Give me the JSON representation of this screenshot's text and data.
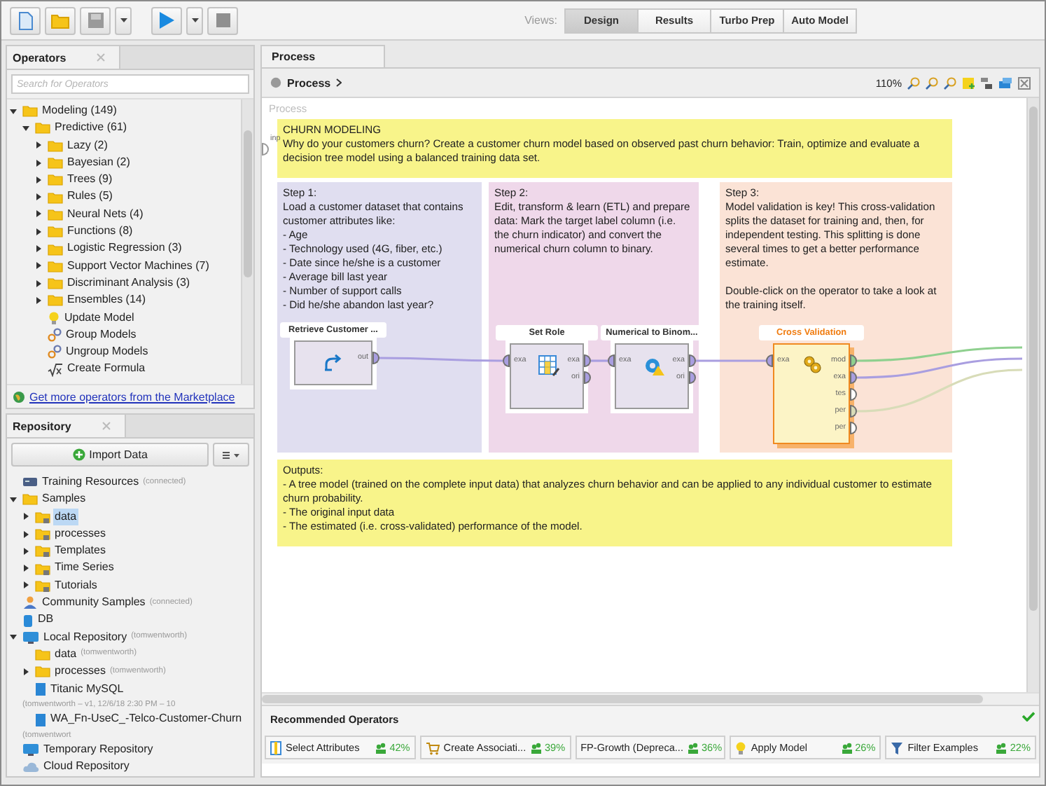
{
  "toolbar": {
    "views_label": "Views:",
    "views": [
      {
        "label": "Design",
        "selected": true
      },
      {
        "label": "Results",
        "selected": false
      },
      {
        "label": "Turbo Prep",
        "selected": false
      },
      {
        "label": "Auto Model",
        "selected": false
      }
    ]
  },
  "operators_panel": {
    "title": "Operators",
    "search": {
      "placeholder": "Search for Operators"
    },
    "tree": [
      {
        "label": "Modeling (149)",
        "kind": "folder",
        "expanded": true,
        "children": [
          {
            "label": "Predictive (61)",
            "kind": "folder",
            "expanded": true,
            "children": [
              {
                "label": "Lazy (2)",
                "kind": "folder",
                "expanded": false
              },
              {
                "label": "Bayesian (2)",
                "kind": "folder",
                "expanded": false
              },
              {
                "label": "Trees (9)",
                "kind": "folder",
                "expanded": false
              },
              {
                "label": "Rules (5)",
                "kind": "folder",
                "expanded": false
              },
              {
                "label": "Neural Nets (4)",
                "kind": "folder",
                "expanded": false
              },
              {
                "label": "Functions (8)",
                "kind": "folder",
                "expanded": false
              },
              {
                "label": "Logistic Regression (3)",
                "kind": "folder",
                "expanded": false
              },
              {
                "label": "Support Vector Machines (7)",
                "kind": "folder",
                "expanded": false
              },
              {
                "label": "Discriminant Analysis (3)",
                "kind": "folder",
                "expanded": false
              },
              {
                "label": "Ensembles (14)",
                "kind": "folder",
                "expanded": false
              },
              {
                "label": "Update Model",
                "kind": "bulb"
              },
              {
                "label": "Group Models",
                "kind": "chain"
              },
              {
                "label": "Ungroup Models",
                "kind": "chain"
              },
              {
                "label": "Create Formula",
                "kind": "formula"
              }
            ]
          }
        ]
      }
    ],
    "marketplace_link": "Get more operators from the Marketplace"
  },
  "repository_panel": {
    "title": "Repository",
    "import_button": "Import Data",
    "tree": [
      {
        "label": "Training Resources",
        "note": "(connected)",
        "kind": "server",
        "selected": false
      },
      {
        "label": "Samples",
        "kind": "folder",
        "expanded": true,
        "selected": false,
        "children": [
          {
            "label": "data",
            "kind": "sample_folder",
            "expanded": false,
            "selected": true
          },
          {
            "label": "processes",
            "kind": "sample_folder",
            "expanded": false,
            "selected": false
          },
          {
            "label": "Templates",
            "kind": "sample_folder",
            "expanded": false,
            "selected": false
          },
          {
            "label": "Time Series",
            "kind": "sample_folder",
            "expanded": false,
            "selected": false
          },
          {
            "label": "Tutorials",
            "kind": "sample_folder",
            "expanded": false,
            "selected": false
          }
        ]
      },
      {
        "label": "Community Samples",
        "note": "(connected)",
        "kind": "community",
        "selected": false
      },
      {
        "label": "DB",
        "kind": "database",
        "selected": false
      },
      {
        "label": "Local Repository",
        "note": "(tomwentworth)",
        "kind": "repository",
        "expanded": true,
        "selected": false,
        "children": [
          {
            "label": "data",
            "note": "(tomwentworth)",
            "kind": "folder",
            "selected": false
          },
          {
            "label": "processes",
            "note": "(tomwentworth)",
            "kind": "folder",
            "expanded": false,
            "selected": false
          },
          {
            "label": "Titanic MySQL",
            "note": "(tomwentworth – v1, 12/6/18 2:30 PM – 10",
            "kind": "datafile",
            "selected": false
          },
          {
            "label": "WA_Fn-UseC_-Telco-Customer-Churn",
            "note": "(tomwentwort",
            "kind": "datafile",
            "selected": false
          }
        ]
      },
      {
        "label": "Temporary Repository",
        "kind": "repository",
        "selected": false
      },
      {
        "label": "Cloud Repository",
        "kind": "cloud",
        "selected": false
      }
    ]
  },
  "process_panel": {
    "tab": "Process",
    "breadcrumb": "Process",
    "zoom": "110%",
    "canvas": {
      "label": "Process",
      "input_port": "inp",
      "notes": [
        {
          "color": "#f8f48a",
          "paragraphs": [
            [
              "CHURN MODELING",
              "Why do your customers churn? Create a customer churn model based on observed past churn behavior: Train, optimize and evaluate a decision tree model using a balanced training data set."
            ]
          ]
        },
        {
          "color": "#e0def0",
          "paragraphs": [
            [
              "Step 1:",
              "Load a customer dataset that contains customer attributes like:",
              "- Age",
              "- Technology used (4G, fiber, etc.)",
              "- Date since he/she is a customer",
              "- Average bill last year",
              "- Number of support calls",
              "- Did he/she abandon last year?"
            ]
          ]
        },
        {
          "color": "#efd8ea",
          "paragraphs": [
            [
              "Step 2:",
              "Edit, transform & learn (ETL) and prepare data: Mark the target label column (i.e. the churn indicator) and convert the numerical churn column to binary."
            ]
          ]
        },
        {
          "color": "#fbe3d6",
          "paragraphs": [
            [
              "Step 3:",
              "Model validation is key! This cross-validation splits the dataset for training and, then, for independent testing. This splitting is done several times to get a better performance estimate."
            ],
            [
              "Double-click on the operator to take a look at the training itself."
            ]
          ]
        },
        {
          "color": "#f8f48a",
          "paragraphs": [
            [
              "Outputs:",
              "- A tree model (trained on the complete input data) that analyzes churn behavior and can be applied to any individual customer to estimate churn probability.",
              "- The original input data",
              "- The estimated (i.e. cross-validated) performance of the model."
            ]
          ]
        }
      ],
      "operators": [
        {
          "title": "Retrieve Customer ...",
          "kind": "retrieve",
          "selected": false,
          "outputs": [
            {
              "label": "out",
              "color": "#a99ee0"
            }
          ]
        },
        {
          "title": "Set Role",
          "kind": "set_role",
          "selected": false,
          "inputs": [
            {
              "label": "exa",
              "color": "#a99ee0"
            }
          ],
          "outputs": [
            {
              "label": "exa",
              "color": "#a99ee0"
            },
            {
              "label": "ori",
              "color": "#a99ee0"
            }
          ]
        },
        {
          "title": "Numerical to Binom...",
          "kind": "convert",
          "selected": false,
          "inputs": [
            {
              "label": "exa",
              "color": "#a99ee0"
            }
          ],
          "outputs": [
            {
              "label": "exa",
              "color": "#a99ee0"
            },
            {
              "label": "ori",
              "color": "#a99ee0"
            }
          ]
        },
        {
          "title": "Cross Validation",
          "kind": "validation",
          "selected": true,
          "inputs": [
            {
              "label": "exa",
              "color": "#a99ee0"
            }
          ],
          "outputs": [
            {
              "label": "mod",
              "color": "#8fd08f"
            },
            {
              "label": "exa",
              "color": "#a99ee0"
            },
            {
              "label": "tes",
              "color": "#ffffff"
            },
            {
              "label": "per",
              "color": "#d8dcb8"
            },
            {
              "label": "per",
              "color": "#ffffff"
            }
          ]
        }
      ]
    },
    "recommended_title": "Recommended Operators",
    "recommended": [
      {
        "label": "Select Attributes",
        "kind": "attributes",
        "share": "42%"
      },
      {
        "label": "Create Associati...",
        "kind": "associations",
        "share": "39%"
      },
      {
        "label": "FP-Growth (Depreca...",
        "kind": "plain",
        "share": "36%"
      },
      {
        "label": "Apply Model",
        "kind": "apply",
        "share": "26%"
      },
      {
        "label": "Filter Examples",
        "kind": "filter",
        "share": "22%"
      }
    ]
  }
}
